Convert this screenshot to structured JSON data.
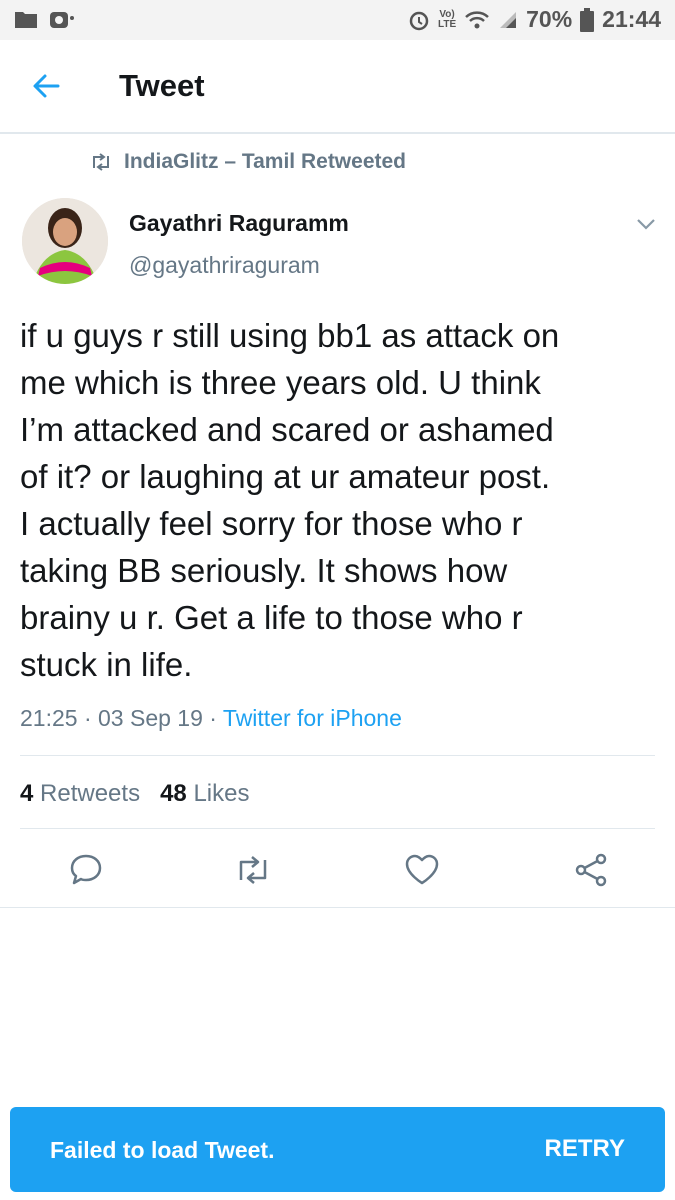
{
  "status_bar": {
    "battery": "70%",
    "time": "21:44",
    "network_top": "Vo)",
    "network_bottom": "LTE"
  },
  "header": {
    "title": "Tweet"
  },
  "retweet_context": {
    "text": "IndiaGlitz – Tamil Retweeted"
  },
  "author": {
    "name": "Gayathri Raguramm",
    "handle": "@gayathriraguram"
  },
  "tweet": {
    "text": "if u guys r still using bb1 as attack on\nme which is three years old. U think\nI’m attacked and scared or ashamed\nof it? or laughing at ur amateur post.\nI actually feel sorry for those who r\ntaking BB seriously. It shows how\nbrainy u r. Get a life to those who r\nstuck in life.",
    "time": "21:25",
    "date": "03 Sep 19",
    "source": "Twitter for iPhone"
  },
  "stats": {
    "retweets_count": "4",
    "retweets_label": "Retweets",
    "likes_count": "48",
    "likes_label": "Likes"
  },
  "icons": [
    "back-arrow-icon",
    "retweet-icon",
    "chevron-down-icon",
    "reply-icon",
    "heart-icon",
    "share-icon"
  ],
  "colors": {
    "accent": "#1da1f2",
    "secondary_text": "#657786"
  },
  "toast": {
    "message": "Failed to load Tweet.",
    "action": "RETRY"
  }
}
